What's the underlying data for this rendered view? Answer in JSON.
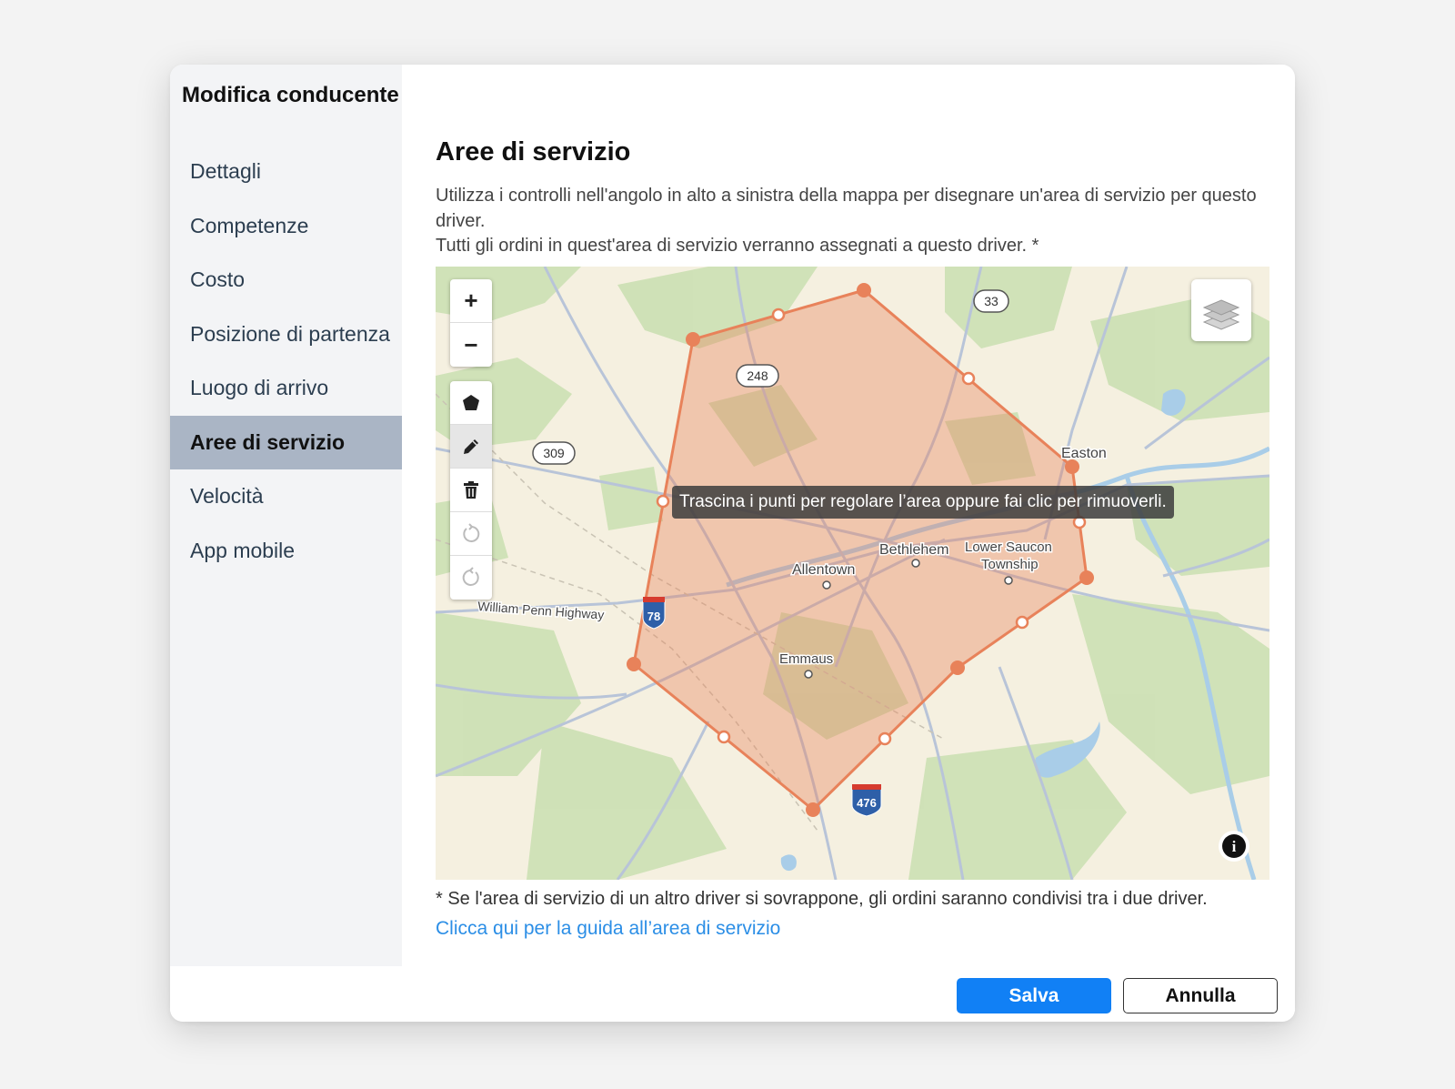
{
  "dialog": {
    "title": "Modifica conducente"
  },
  "sidebar": {
    "items": [
      {
        "label": "Dettagli",
        "active": false
      },
      {
        "label": "Competenze",
        "active": false
      },
      {
        "label": "Costo",
        "active": false
      },
      {
        "label": "Posizione di partenza",
        "active": false
      },
      {
        "label": "Luogo di arrivo",
        "active": false
      },
      {
        "label": "Aree di servizio",
        "active": true
      },
      {
        "label": "Velocità",
        "active": false
      },
      {
        "label": "App mobile",
        "active": false
      }
    ]
  },
  "main": {
    "title": "Aree di servizio",
    "description_line1": "Utilizza i controlli nell'angolo in alto a sinistra della mappa per disegnare un'area di servizio per questo driver.",
    "description_line2": "Tutti gli ordini in quest'area di servizio verranno assegnati a questo driver. *",
    "footnote": "* Se l'area di servizio di un altro driver si sovrappone, gli ordini saranno condivisi tra i due driver.",
    "guide_link": "Clicca qui per la guida all’area di servizio"
  },
  "map": {
    "tooltip": "Trascina i punti per regolare l’area oppure fai clic per rimuoverli.",
    "controls": {
      "zoom_in": "+",
      "zoom_out": "−"
    },
    "tools": [
      "polygon-icon",
      "pencil-icon",
      "trash-icon",
      "undo-icon",
      "redo-icon"
    ],
    "active_tool": "pencil-icon",
    "places": {
      "allentown": "Allentown",
      "bethlehem": "Bethlehem",
      "easton": "Easton",
      "lower_saucon": "Lower Saucon",
      "township": "Township",
      "emmaus": "Emmaus",
      "william_penn": "William Penn Highway"
    },
    "route_shields": {
      "r33": "33",
      "r248": "248",
      "r309": "309",
      "i78": "78",
      "i476": "476"
    },
    "polygon_color": "#e8825a",
    "info_label": "i"
  },
  "footer": {
    "save_label": "Salva",
    "cancel_label": "Annulla"
  },
  "colors": {
    "primary": "#1180f5",
    "link": "#2b8ee6",
    "sidebar_active": "#aab5c5"
  }
}
